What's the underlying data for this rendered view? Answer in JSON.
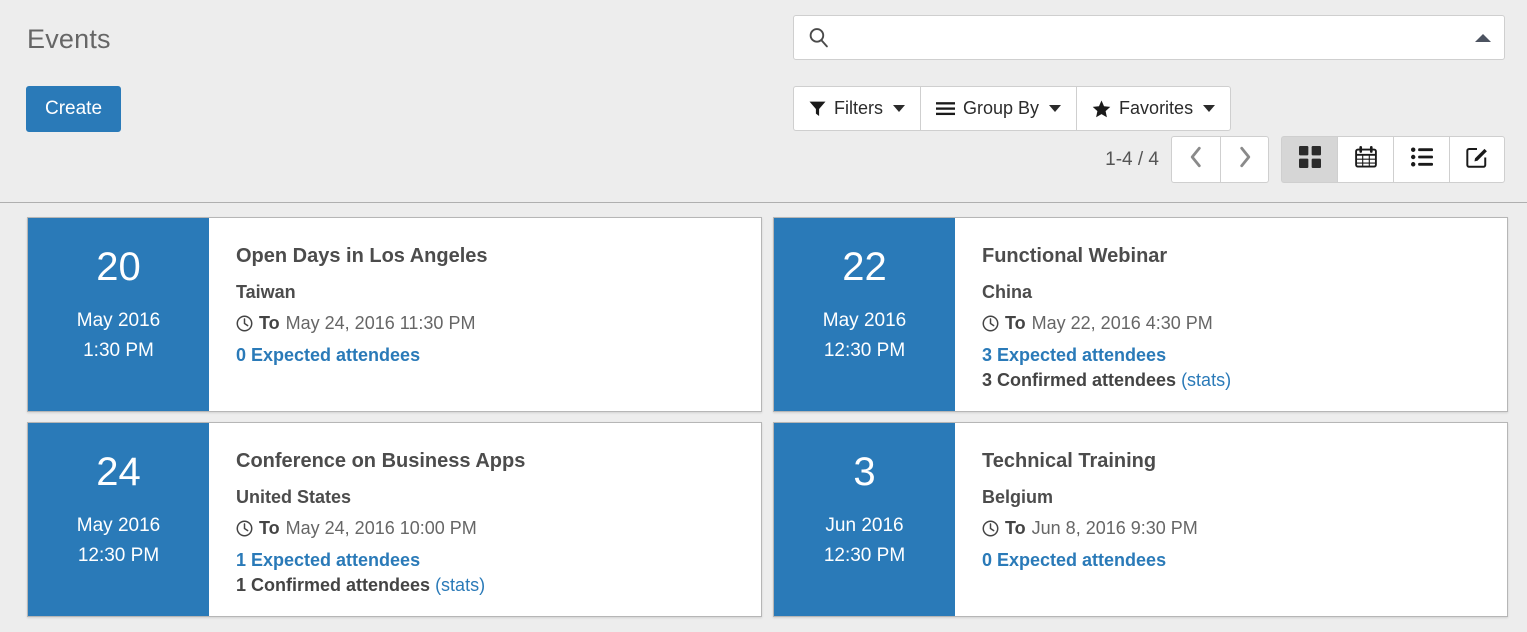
{
  "header": {
    "title": "Events",
    "create_label": "Create"
  },
  "search": {
    "value": "",
    "placeholder": "",
    "icon": "search-icon",
    "toggle_icon": "caret-up-icon"
  },
  "filter_buttons": [
    {
      "label": "Filters",
      "icon": "filter-funnel-icon"
    },
    {
      "label": "Group By",
      "icon": "hamburger-lines-icon"
    },
    {
      "label": "Favorites",
      "icon": "star-icon"
    }
  ],
  "pager": {
    "count_label": "1-4 / 4",
    "previous_icon": "chevron-left-icon",
    "next_icon": "chevron-right-icon"
  },
  "view_switcher": [
    {
      "name": "kanban",
      "icon": "grid-squares-icon",
      "active": true
    },
    {
      "name": "calendar",
      "icon": "calendar-icon",
      "active": false
    },
    {
      "name": "list",
      "icon": "list-bullets-icon",
      "active": false
    },
    {
      "name": "form",
      "icon": "pencil-square-icon",
      "active": false
    }
  ],
  "accent_color": "#2a7ab8",
  "cards": [
    {
      "day": "20",
      "month_year": "May 2016",
      "time": "1:30 PM",
      "title": "Open Days in Los Angeles",
      "country": "Taiwan",
      "to_label": "To",
      "to_date": "May 24, 2016 11:30 PM",
      "expected": "0 Expected attendees",
      "confirmed": "",
      "stats": ""
    },
    {
      "day": "22",
      "month_year": "May 2016",
      "time": "12:30 PM",
      "title": "Functional Webinar",
      "country": "China",
      "to_label": "To",
      "to_date": "May 22, 2016 4:30 PM",
      "expected": "3 Expected attendees",
      "confirmed": "3 Confirmed attendees",
      "stats": "(stats)"
    },
    {
      "day": "24",
      "month_year": "May 2016",
      "time": "12:30 PM",
      "title": "Conference on Business Apps",
      "country": "United States",
      "to_label": "To",
      "to_date": "May 24, 2016 10:00 PM",
      "expected": "1 Expected attendees",
      "confirmed": "1 Confirmed attendees",
      "stats": "(stats)"
    },
    {
      "day": "3",
      "month_year": "Jun 2016",
      "time": "12:30 PM",
      "title": "Technical Training",
      "country": "Belgium",
      "to_label": "To",
      "to_date": "Jun 8, 2016 9:30 PM",
      "expected": "0 Expected attendees",
      "confirmed": "",
      "stats": ""
    }
  ]
}
